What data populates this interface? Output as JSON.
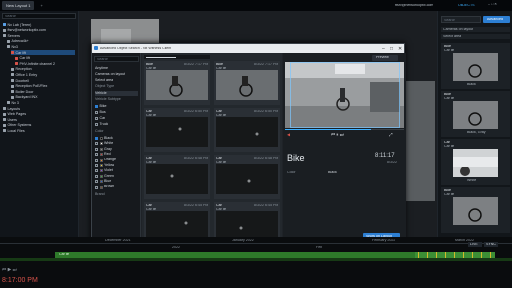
{
  "window": {
    "tabs": [
      "New Layout 1",
      "+"
    ],
    "user_email": "ftsrv@networkoptix.com",
    "status": "OBJECTS"
  },
  "left_panel": {
    "search_placeholder": "Search",
    "items": [
      {
        "label": "Nx Lab (Teren)",
        "icon_color": "#5aa0e6",
        "indent": 0
      },
      {
        "label": "ftsrv@networkoptix.com",
        "icon_color": "#9aa3ad",
        "indent": 0
      },
      {
        "label": "Servers",
        "icon_color": "#9aa3ad",
        "indent": 0
      },
      {
        "label": "Adreca4k+",
        "icon_color": "#9aa3ad",
        "indent": 1
      },
      {
        "label": "Nx3",
        "icon_color": "#9aa3ad",
        "indent": 1
      },
      {
        "label": "Car lift",
        "icon_color": "#d6534a",
        "indent": 2
      },
      {
        "label": "Car lift",
        "icon_color": "#d6534a",
        "indent": 3
      },
      {
        "label": "PHV-Infinite channel 2",
        "icon_color": "#d6534a",
        "indent": 3
      },
      {
        "label": "Reception",
        "icon_color": "#9aa3ad",
        "indent": 2
      },
      {
        "label": "Office 1 Entry",
        "icon_color": "#9aa3ad",
        "indent": 2
      },
      {
        "label": "Doorbell",
        "icon_color": "#9aa3ad",
        "indent": 2
      },
      {
        "label": "Reception PoE/Flex",
        "icon_color": "#9aa3ad",
        "indent": 2
      },
      {
        "label": "Boiler Door",
        "icon_color": "#9aa3ad",
        "indent": 2
      },
      {
        "label": "Backyard INX",
        "icon_color": "#9aa3ad",
        "indent": 2
      },
      {
        "label": "Nx 3",
        "icon_color": "#9aa3ad",
        "indent": 1
      },
      {
        "label": "Layouts",
        "icon_color": "#9aa3ad",
        "indent": 0
      },
      {
        "label": "Web Pages",
        "icon_color": "#9aa3ad",
        "indent": 0
      },
      {
        "label": "Users",
        "icon_color": "#9aa3ad",
        "indent": 0
      },
      {
        "label": "Other Systems",
        "icon_color": "#9aa3ad",
        "indent": 0
      },
      {
        "label": "Local Files",
        "icon_color": "#9aa3ad",
        "indent": 0
      }
    ]
  },
  "dialog": {
    "title": "Advanced Object Search - Nx Witness Client",
    "filters": {
      "search_placeholder": "Search",
      "rows": [
        {
          "label": "Anytime",
          "checkbox": false
        },
        {
          "label": "Cameras on layout",
          "checkbox": false
        },
        {
          "label": "Select area",
          "checkbox": false
        },
        {
          "label": "Object Type",
          "checkbox": false,
          "heading": true
        },
        {
          "label": "Vehicle",
          "checkbox": false,
          "selected": true
        },
        {
          "label": "Vehicle Subtype",
          "checkbox": false,
          "heading": true
        },
        {
          "label": "Bike",
          "checkbox": true,
          "checked": true
        },
        {
          "label": "Bus",
          "checkbox": true,
          "checked": false
        },
        {
          "label": "Car",
          "checkbox": true,
          "checked": false
        },
        {
          "label": "Truck",
          "checkbox": true,
          "checked": false
        }
      ],
      "color_heading": "Color",
      "colors": [
        {
          "label": "Black",
          "swatch": "#000000"
        },
        {
          "label": "White",
          "swatch": "#ffffff"
        },
        {
          "label": "Gray",
          "swatch": "#8c8c8c"
        },
        {
          "label": "Red",
          "swatch": "#d63b3b"
        },
        {
          "label": "Orange",
          "swatch": "#e58a2c"
        },
        {
          "label": "Yellow",
          "swatch": "#e5d13c"
        },
        {
          "label": "Violet",
          "swatch": "#8d4fd6"
        },
        {
          "label": "Green",
          "swatch": "#3cb04a"
        },
        {
          "label": "Blue",
          "swatch": "#2d62d6"
        },
        {
          "label": "Brown",
          "swatch": "#7a4f2e"
        }
      ],
      "brand_heading": "Brand"
    },
    "results": [
      {
        "type": "Bike",
        "camera": "Car lift",
        "time": "8/3/22 7:17 PM"
      },
      {
        "type": "Bike",
        "camera": "Car lift",
        "time": "8/3/22 7:17 PM"
      },
      {
        "type": "Car",
        "camera": "Car lift",
        "time": "8/3/22 6:50 PM"
      },
      {
        "type": "Car",
        "camera": "Car lift",
        "time": "8/3/22 6:50 PM"
      },
      {
        "type": "Car",
        "camera": "Car lift",
        "time": "8/3/22 6:48 PM"
      },
      {
        "type": "Car",
        "camera": "Car lift",
        "time": "8/3/22 6:48 PM"
      },
      {
        "type": "Car",
        "camera": "Car lift",
        "time": "8/3/22 6:45 PM"
      },
      {
        "type": "Car",
        "camera": "Car lift",
        "time": "8/3/22 6:45 PM"
      }
    ],
    "preview_label": "Preview",
    "detail": {
      "title": "Bike",
      "time": "8:11:17",
      "date": "8/3/22",
      "attribute_key": "Color",
      "attribute_value": "Black",
      "button": "Show on Layout",
      "progress": 0.72
    }
  },
  "right_panel": {
    "search_placeholder": "Search",
    "advanced_button": "Advanced",
    "selects": [
      "Cameras on layout",
      "Select area"
    ],
    "items": [
      {
        "type": "Bike",
        "camera": "Car lift",
        "attr": "Black"
      },
      {
        "type": "Bike",
        "camera": "Car lift",
        "attr": "Black, Gray"
      },
      {
        "type": "Car",
        "camera": "Car lift",
        "attr": "White"
      },
      {
        "type": "Bike",
        "camera": "Car lift",
        "attr": ""
      }
    ]
  },
  "timeline": {
    "months": [
      "December 2021",
      "January 2022",
      "February 2022",
      "March 2022"
    ],
    "year_marks": [
      "2022",
      "Feb"
    ],
    "camera_label": "Car lift",
    "clock": "8:17:00 PM",
    "live_buttons": [
      "LIVE",
      "SYNC"
    ]
  }
}
